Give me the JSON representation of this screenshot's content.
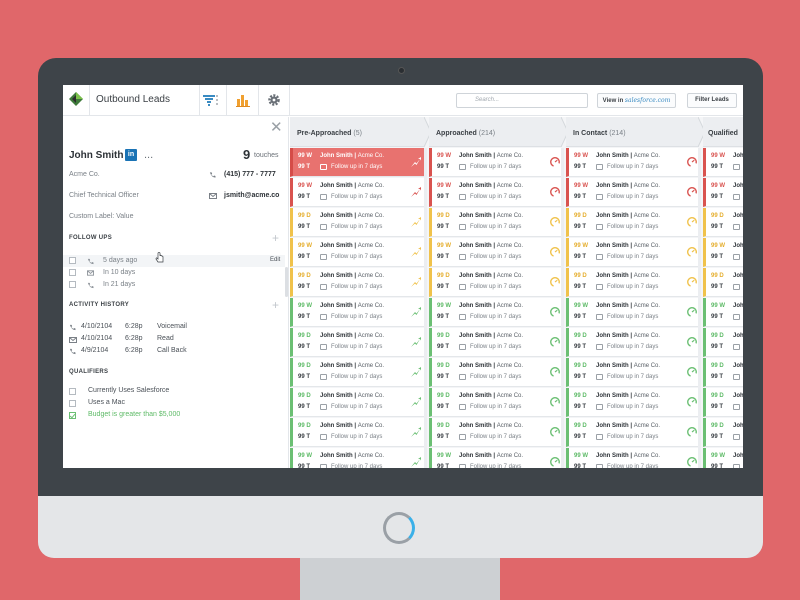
{
  "header": {
    "title": "Outbound Leads",
    "search_placeholder": "Search...",
    "view_in_label": "View in",
    "view_in_brand": "salesforce.com",
    "filter_label": "Filter Leads"
  },
  "contact": {
    "close": "✕",
    "name": "John Smith",
    "linkedin": "in",
    "more": "...",
    "touches_count": "9",
    "touches_label": "touches",
    "company": "Acme Co.",
    "phone": "(415) 777 - 7777",
    "title": "Chief Technical Officer",
    "email": "jsmith@acme.co",
    "custom_label": "Custom Label: Value"
  },
  "follow_ups": {
    "title": "FOLLOW UPS",
    "edit": "Edit",
    "items": [
      "5 days ago",
      "In 10 days",
      "In 21 days"
    ]
  },
  "activity": {
    "title": "ACTIVITY HISTORY",
    "items": [
      {
        "date": "4/10/2104",
        "time": "6:28p",
        "action": "Voicemail"
      },
      {
        "date": "4/10/2104",
        "time": "6:28p",
        "action": "Read"
      },
      {
        "date": "4/9/2104",
        "time": "6:28p",
        "action": "Call Back"
      }
    ]
  },
  "qualifiers": {
    "title": "QUALIFIERS",
    "items": [
      {
        "label": "Currently Uses Salesforce",
        "checked": false
      },
      {
        "label": "Uses a Mac",
        "checked": false
      },
      {
        "label": "Budget is greater than $5,000",
        "checked": true
      }
    ]
  },
  "columns": [
    {
      "name": "Pre-Approached",
      "count": "(5)"
    },
    {
      "name": "Approached",
      "count": "(214)"
    },
    {
      "name": "In Contact",
      "count": "(214)"
    },
    {
      "name": "Qualified",
      "count": ""
    }
  ],
  "card": {
    "name": "John Smith",
    "company": "Acme Co.",
    "followup": "Follow up in 7 days",
    "t_score": "99 T"
  },
  "rows": [
    {
      "w": "99 W",
      "status": "red"
    },
    {
      "w": "99 W",
      "status": "red"
    },
    {
      "w": "99 D",
      "status": "yellow"
    },
    {
      "w": "99 W",
      "status": "yellow"
    },
    {
      "w": "99 D",
      "status": "yellow"
    },
    {
      "w": "99 W",
      "status": "green"
    },
    {
      "w": "99 D",
      "status": "green"
    },
    {
      "w": "99 D",
      "status": "green"
    },
    {
      "w": "99 D",
      "status": "green"
    },
    {
      "w": "99 D",
      "status": "green"
    },
    {
      "w": "99 W",
      "status": "green"
    }
  ],
  "colors": {
    "red": "#d9534f",
    "yellow": "#f0c24b",
    "green": "#6bbf73",
    "highlight": "#e8726f"
  }
}
